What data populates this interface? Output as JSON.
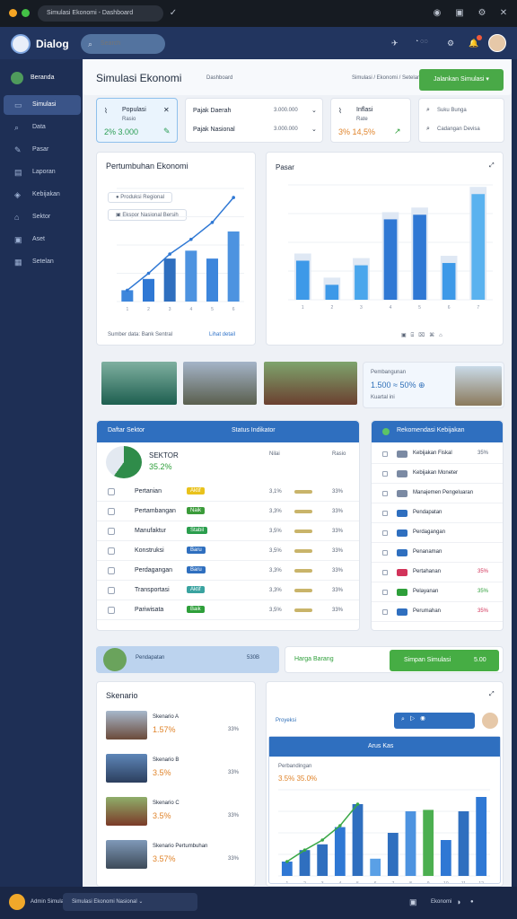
{
  "titlebar": {
    "url": "Simulasi Ekonomi - Dashboard"
  },
  "header": {
    "app_title": "Dialog",
    "search_placeholder": "Search",
    "icons": [
      "send-icon",
      "profile-icon",
      "settings-icon",
      "notifications-icon",
      "avatar"
    ]
  },
  "sidebar": {
    "items": [
      {
        "label": "Beranda",
        "icon": "home-icon",
        "active": false
      },
      {
        "label": "Simulasi",
        "icon": "chart-icon",
        "active": true
      },
      {
        "label": "Data",
        "icon": "search-icon",
        "active": false
      },
      {
        "label": "Pasar",
        "icon": "edit-icon",
        "active": false
      },
      {
        "label": "Laporan",
        "icon": "doc-icon",
        "active": false
      },
      {
        "label": "Kebijakan",
        "icon": "policy-icon",
        "active": false
      },
      {
        "label": "Sektor",
        "icon": "building-icon",
        "active": false
      },
      {
        "label": "Aset",
        "icon": "wallet-icon",
        "active": false
      },
      {
        "label": "Setelan",
        "icon": "grid-icon",
        "active": false
      }
    ]
  },
  "page": {
    "title": "Simulasi Ekonomi",
    "subtitle": "Dashboard",
    "breadcrumb": "Simulasi / Ekonomi / Setelan",
    "action_button": "Jalankan Simulasi"
  },
  "filters": {
    "card1": {
      "label": "Populasi",
      "sub": "Rasio",
      "value": "2% 3.000"
    },
    "card2": {
      "rows": [
        {
          "label": "Pajak Daerah",
          "value": "3.000.000"
        },
        {
          "label": "Pajak Nasional",
          "value": "3.000.000"
        }
      ]
    },
    "card3": {
      "label": "Inflasi",
      "sub": "Rate",
      "value": "3% 14,5%"
    },
    "card4": {
      "rows": [
        {
          "label": "Suku Bunga"
        },
        {
          "label": "Cadangan Devisa"
        }
      ]
    }
  },
  "growth_card": {
    "title": "Pertumbuhan Ekonomi",
    "legend": [
      {
        "label": "Produksi Regional"
      },
      {
        "label": "Ekspor Nasional Bersih"
      }
    ],
    "footer_left": "Sumber data: Bank Sentral",
    "footer_right": "Lihat detail"
  },
  "market_card": {
    "title": "Pasar"
  },
  "banner": {
    "title": "Pembangunan",
    "value": "1.500 ≈ 50% ⊕",
    "sub": "Kuartal ini"
  },
  "table_card": {
    "header": "Daftar Sektor",
    "header_right": "Status Indikator",
    "summary_title": "SEKTOR",
    "summary_value": "35.2%",
    "summary_unit": "%",
    "cols": [
      "Nilai",
      "Rasio"
    ],
    "rows": [
      {
        "name": "Pertanian",
        "tag": "Aktif",
        "v1": "3,1%",
        "v2": "33%"
      },
      {
        "name": "Pertambangan",
        "tag": "Naik",
        "v1": "3,3%",
        "v2": "33%"
      },
      {
        "name": "Manufaktur",
        "tag": "Stabil",
        "v1": "3,5%",
        "v2": "33%"
      },
      {
        "name": "Konstruksi",
        "tag": "Baru",
        "v1": "3,5%",
        "v2": "33%"
      },
      {
        "name": "Perdagangan",
        "tag": "Baru",
        "v1": "3,3%",
        "v2": "33%"
      },
      {
        "name": "Transportasi",
        "tag": "Aktif",
        "v1": "3,3%",
        "v2": "33%"
      },
      {
        "name": "Pariwisata",
        "tag": "Baik",
        "v1": "3,5%",
        "v2": "33%"
      }
    ]
  },
  "side_card": {
    "header": "Rekomendasi Kebijakan",
    "rows": [
      {
        "label": "Kebijakan Fiskal",
        "value": "35%"
      },
      {
        "label": "Kebijakan Moneter",
        "value": ""
      },
      {
        "label": "Manajemen Pengeluaran",
        "value": ""
      },
      {
        "label": "Pendapatan",
        "value": ""
      },
      {
        "label": "Perdagangan",
        "value": ""
      },
      {
        "label": "Penanaman",
        "value": ""
      },
      {
        "label": "Pertahanan",
        "value": "35%"
      },
      {
        "label": "Pelayanan",
        "value": "35%"
      },
      {
        "label": "Perumahan",
        "value": "35%"
      }
    ]
  },
  "bar2": {
    "left_title": "Pendapatan",
    "left_value": "530B",
    "right_label": "Harga Barang",
    "right_button": "Simpan Simulasi",
    "right_value": "5.00"
  },
  "list_card": {
    "title": "Skenario",
    "items": [
      {
        "name": "Skenario A",
        "value": "1.57%",
        "v2": "33%"
      },
      {
        "name": "Skenario B",
        "value": "3.5%",
        "v2": "33%"
      },
      {
        "name": "Skenario C",
        "value": "3.5%",
        "v2": "33%"
      },
      {
        "name": "Skenario Pertumbuhan",
        "value": "3.57%",
        "v2": "33%"
      }
    ]
  },
  "forecast_card": {
    "header": "Proyeksi",
    "panel_header": "Arus Kas",
    "panel_title": "Perbandingan",
    "panel_value": "3.5% 35.0%"
  },
  "footer": {
    "user": "Admin Simulasi",
    "select": "Simulasi Ekonomi Nasional",
    "right": "Ekonomi"
  },
  "chart_data": [
    {
      "type": "bar",
      "id": "growth",
      "categories": [
        "1",
        "2",
        "3",
        "4",
        "5",
        "6"
      ],
      "values": [
        10,
        20,
        38,
        45,
        38,
        62
      ],
      "line": [
        10,
        25,
        42,
        55,
        70,
        92
      ],
      "ylim": [
        0,
        100
      ]
    },
    {
      "type": "bar",
      "id": "market",
      "categories": [
        "1",
        "2",
        "3",
        "4",
        "5",
        "6",
        "7"
      ],
      "values": [
        34,
        13,
        30,
        70,
        74,
        32,
        92
      ],
      "ylim": [
        0,
        100
      ]
    },
    {
      "type": "bar",
      "id": "forecast",
      "categories": [
        "1",
        "2",
        "3",
        "4",
        "5",
        "6",
        "7",
        "8",
        "9",
        "10",
        "11",
        "12"
      ],
      "values": [
        10,
        18,
        22,
        34,
        50,
        12,
        30,
        45,
        46,
        25,
        45,
        55
      ],
      "line": [
        10,
        18,
        25,
        35,
        50
      ],
      "ylim": [
        0,
        60
      ]
    }
  ]
}
